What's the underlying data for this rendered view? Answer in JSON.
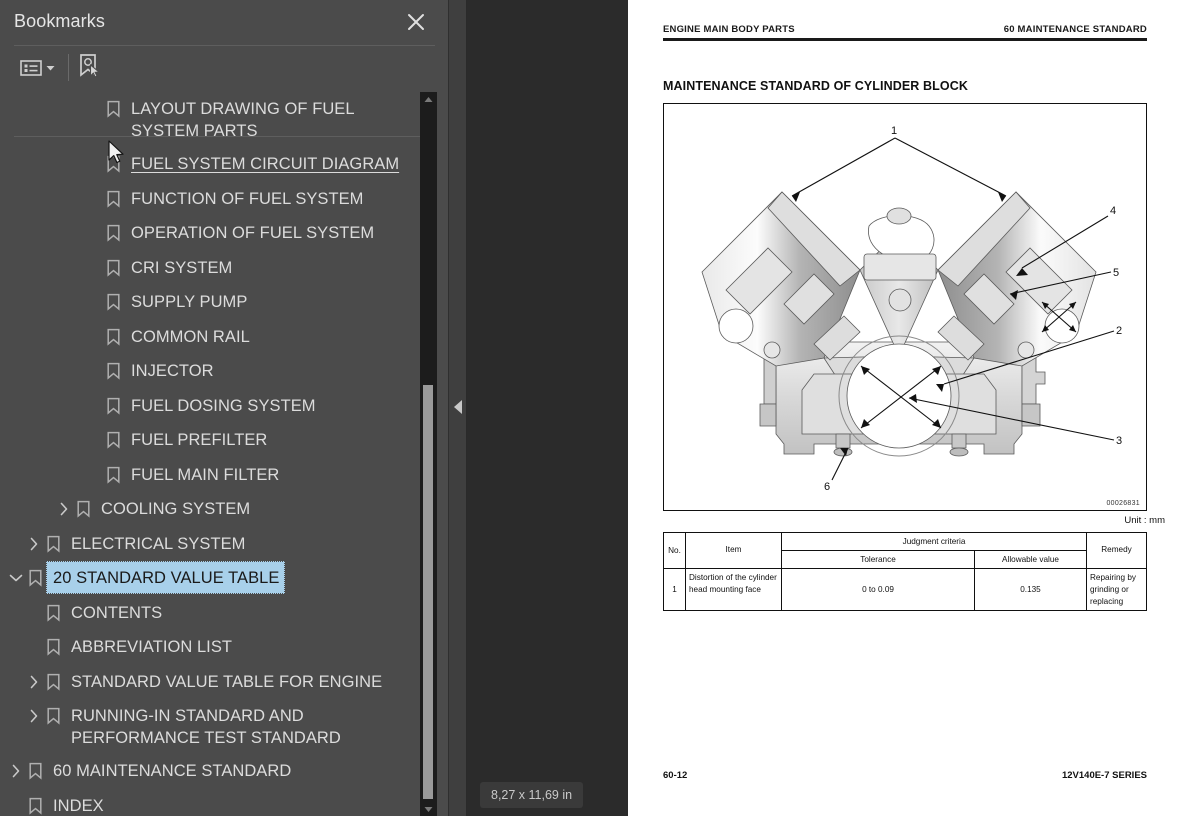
{
  "sidebar": {
    "title": "Bookmarks",
    "close_icon": "close-icon",
    "toolbar": {
      "options_icon": "list-options-icon",
      "options_chevron_icon": "chevron-down-icon",
      "new_bookmark_icon": "bookmark-pointer-icon"
    },
    "items": [
      {
        "label": "LAYOUT DRAWING OF FUEL SYSTEM PARTS",
        "indent": 3,
        "twisty": "none",
        "state": "normal"
      },
      {
        "label": "FUEL SYSTEM CIRCUIT DIAGRAM",
        "indent": 3,
        "twisty": "none",
        "state": "hovered"
      },
      {
        "label": "FUNCTION OF FUEL SYSTEM",
        "indent": 3,
        "twisty": "none",
        "state": "normal"
      },
      {
        "label": "OPERATION OF FUEL SYSTEM",
        "indent": 3,
        "twisty": "none",
        "state": "normal"
      },
      {
        "label": "CRI SYSTEM",
        "indent": 3,
        "twisty": "none",
        "state": "normal"
      },
      {
        "label": "SUPPLY PUMP",
        "indent": 3,
        "twisty": "none",
        "state": "normal"
      },
      {
        "label": "COMMON RAIL",
        "indent": 3,
        "twisty": "none",
        "state": "normal"
      },
      {
        "label": "INJECTOR",
        "indent": 3,
        "twisty": "none",
        "state": "normal"
      },
      {
        "label": "FUEL DOSING SYSTEM",
        "indent": 3,
        "twisty": "none",
        "state": "normal"
      },
      {
        "label": "FUEL PREFILTER",
        "indent": 3,
        "twisty": "none",
        "state": "normal"
      },
      {
        "label": "FUEL MAIN FILTER",
        "indent": 3,
        "twisty": "none",
        "state": "normal"
      },
      {
        "label": "COOLING SYSTEM",
        "indent": 2,
        "twisty": "collapsed",
        "state": "normal"
      },
      {
        "label": "ELECTRICAL SYSTEM",
        "indent": 1,
        "twisty": "collapsed",
        "state": "normal"
      },
      {
        "label": "20 STANDARD VALUE TABLE",
        "indent": 0,
        "twisty": "expanded",
        "state": "selected"
      },
      {
        "label": "CONTENTS",
        "indent": 1,
        "twisty": "none",
        "state": "normal"
      },
      {
        "label": "ABBREVIATION LIST",
        "indent": 1,
        "twisty": "none",
        "state": "normal"
      },
      {
        "label": "STANDARD VALUE TABLE FOR ENGINE",
        "indent": 1,
        "twisty": "collapsed",
        "state": "normal"
      },
      {
        "label": "RUNNING-IN STANDARD AND PERFORMANCE TEST STANDARD",
        "indent": 1,
        "twisty": "collapsed",
        "state": "normal"
      },
      {
        "label": "60 MAINTENANCE STANDARD",
        "indent": 0,
        "twisty": "collapsed",
        "state": "normal"
      },
      {
        "label": "INDEX",
        "indent": 0,
        "twisty": "none",
        "state": "normal"
      }
    ],
    "scrollbar": {
      "up_icon": "scroll-up-arrow-icon",
      "down_icon": "scroll-down-arrow-icon"
    }
  },
  "splitter": {
    "collapse_icon": "collapse-left-arrow-icon"
  },
  "viewer": {
    "page_size_tooltip": "8,27 x 11,69 in"
  },
  "document": {
    "header_left": "ENGINE MAIN BODY PARTS",
    "header_right": "60 MAINTENANCE STANDARD",
    "title": "MAINTENANCE STANDARD OF CYLINDER BLOCK",
    "figure": {
      "reference": "00026831",
      "alt": "Cut-away front view of a V-type engine cylinder block with measurement callouts",
      "callouts": [
        "1",
        "2",
        "3",
        "4",
        "5",
        "6"
      ]
    },
    "unit_note": "Unit : mm",
    "table": {
      "headers": [
        "No.",
        "Item",
        "Judgment criteria",
        "Remedy"
      ],
      "sub_headers": [
        "Tolerance",
        "Allowable value"
      ],
      "rows": [
        {
          "no": "1",
          "item": "Distortion of the cylinder head mounting face",
          "tolerance": "0 to 0.09",
          "allowable": "0.135",
          "remedy": "Repairing by grinding or replacing"
        }
      ]
    },
    "footer_left": "60-12",
    "footer_right": "12V140E-7 SERIES"
  },
  "colors": {
    "sidebar_bg": "#4b4b4b",
    "viewer_bg": "#2b2b2b",
    "selection": "#a8d0ea",
    "page_bg": "#ffffff",
    "text": "#dcdcdc"
  }
}
